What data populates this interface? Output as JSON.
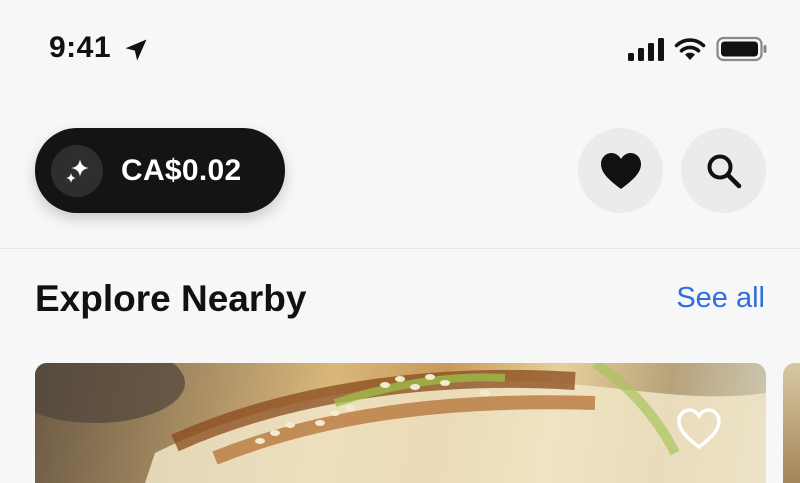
{
  "status_bar": {
    "time": "9:41",
    "icons": [
      "location-arrow-icon",
      "cellular-signal-icon",
      "wifi-icon",
      "battery-icon"
    ]
  },
  "header": {
    "balance": "CA$0.02",
    "balance_icon": "sparkle-icon",
    "buttons": [
      "heart-icon",
      "search-icon"
    ]
  },
  "section": {
    "title": "Explore Nearby",
    "see_all": "See all"
  },
  "card": {
    "image": "sushi-roll-photo",
    "favorite_icon": "heart-outline-icon"
  },
  "colors": {
    "background": "#f7f7f7",
    "pill": "#141414",
    "link": "#2f6fdb",
    "button_bg": "#ebebeb"
  }
}
